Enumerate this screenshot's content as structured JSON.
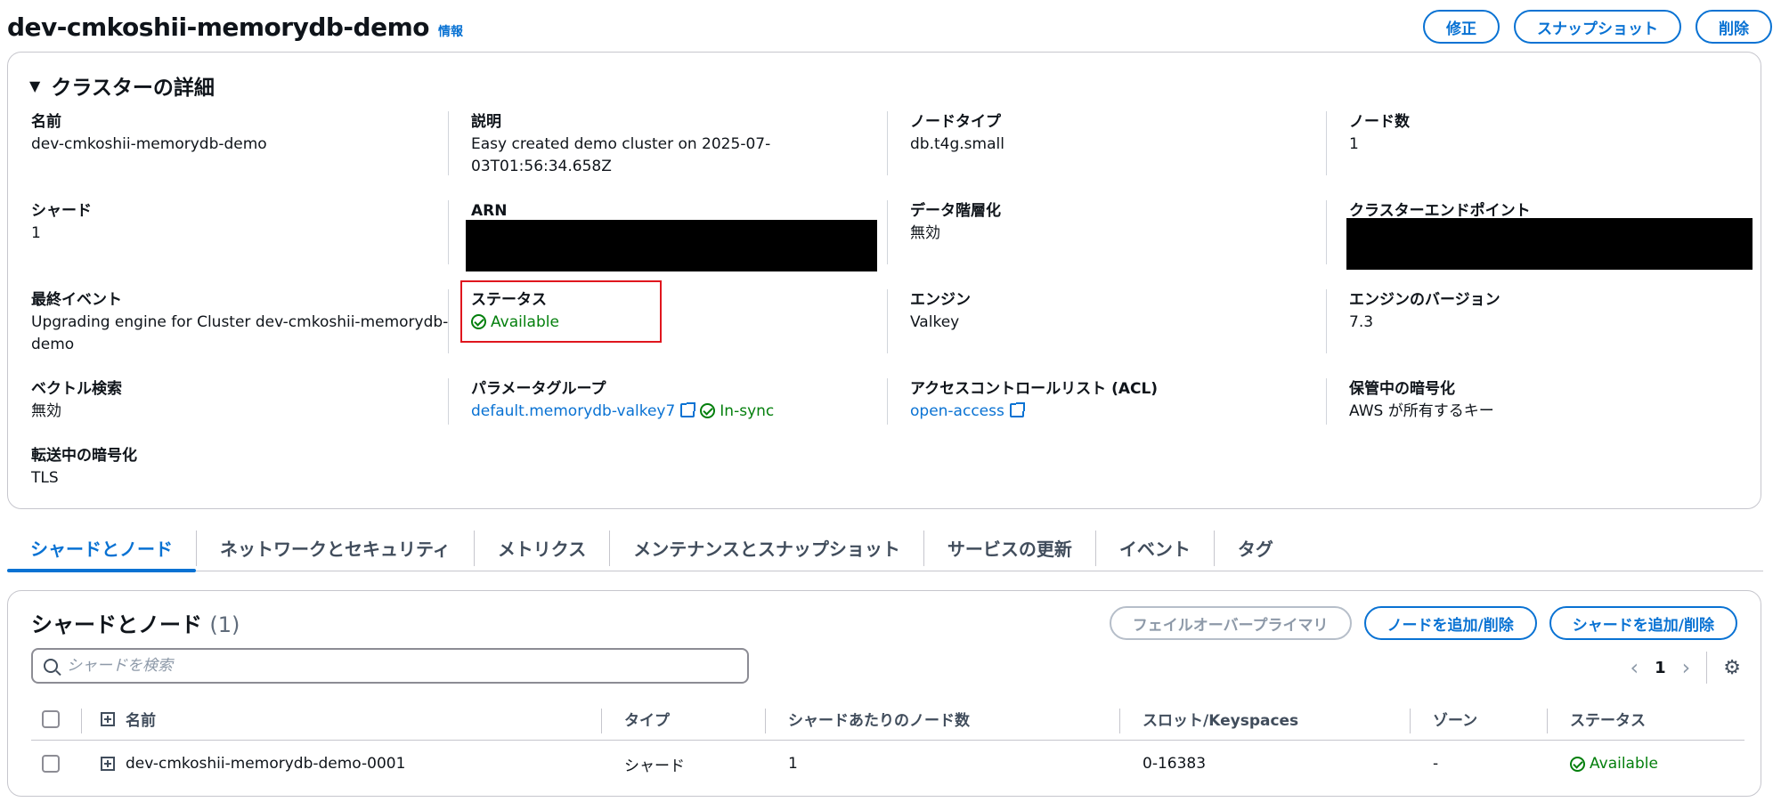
{
  "header": {
    "title": "dev-cmkoshii-memorydb-demo",
    "info": "情報",
    "buttons": {
      "modify": "修正",
      "snapshot": "スナップショット",
      "delete": "削除"
    }
  },
  "details": {
    "section_title": "クラスターの詳細",
    "name_label": "名前",
    "name_value": "dev-cmkoshii-memorydb-demo",
    "desc_label": "説明",
    "desc_value_1": "Easy created demo cluster on 2025-07-",
    "desc_value_2": "03T01:56:34.658Z",
    "node_type_label": "ノードタイプ",
    "node_type_value": "db.t4g.small",
    "node_count_label": "ノード数",
    "node_count_value": "1",
    "shard_label": "シャード",
    "shard_value": "1",
    "arn_label": "ARN",
    "tiering_label": "データ階層化",
    "tiering_value": "無効",
    "endpoint_label": "クラスターエンドポイント",
    "last_event_label": "最終イベント",
    "last_event_value_1": "Upgrading engine for Cluster dev-cmkoshii-memorydb-",
    "last_event_value_2": "demo",
    "status_label": "ステータス",
    "status_value": "Available",
    "engine_label": "エンジン",
    "engine_value": "Valkey",
    "engine_version_label": "エンジンのバージョン",
    "engine_version_value": "7.3",
    "vector_label": "ベクトル検索",
    "vector_value": "無効",
    "param_group_label": "パラメータグループ",
    "param_group_value": "default.memorydb-valkey7",
    "param_sync": "In-sync",
    "acl_label": "アクセスコントロールリスト (ACL)",
    "acl_value": "open-access",
    "at_rest_label": "保管中の暗号化",
    "at_rest_value": "AWS が所有するキー",
    "in_transit_label": "転送中の暗号化",
    "in_transit_value": "TLS"
  },
  "tabs": [
    "シャードとノード",
    "ネットワークとセキュリティ",
    "メトリクス",
    "メンテナンスとスナップショット",
    "サービスの更新",
    "イベント",
    "タグ"
  ],
  "shards": {
    "title": "シャードとノード",
    "count": "(1)",
    "buttons": {
      "failover": "フェイルオーバープライマリ",
      "add_node": "ノードを追加/削除",
      "add_shard": "シャードを追加/削除"
    },
    "search_placeholder": "シャードを検索",
    "page": "1",
    "columns": {
      "name": "名前",
      "type": "タイプ",
      "nodes_per_shard": "シャードあたりのノード数",
      "slots": "スロット/Keyspaces",
      "zone": "ゾーン",
      "status": "ステータス"
    },
    "rows": [
      {
        "name": "dev-cmkoshii-memorydb-demo-0001",
        "type": "シャード",
        "nodes": "1",
        "slots": "0-16383",
        "zone": "-",
        "status": "Available"
      }
    ]
  },
  "colors": {
    "accent": "#0972d3",
    "success": "#037f0c",
    "highlight": "#e0161e"
  }
}
